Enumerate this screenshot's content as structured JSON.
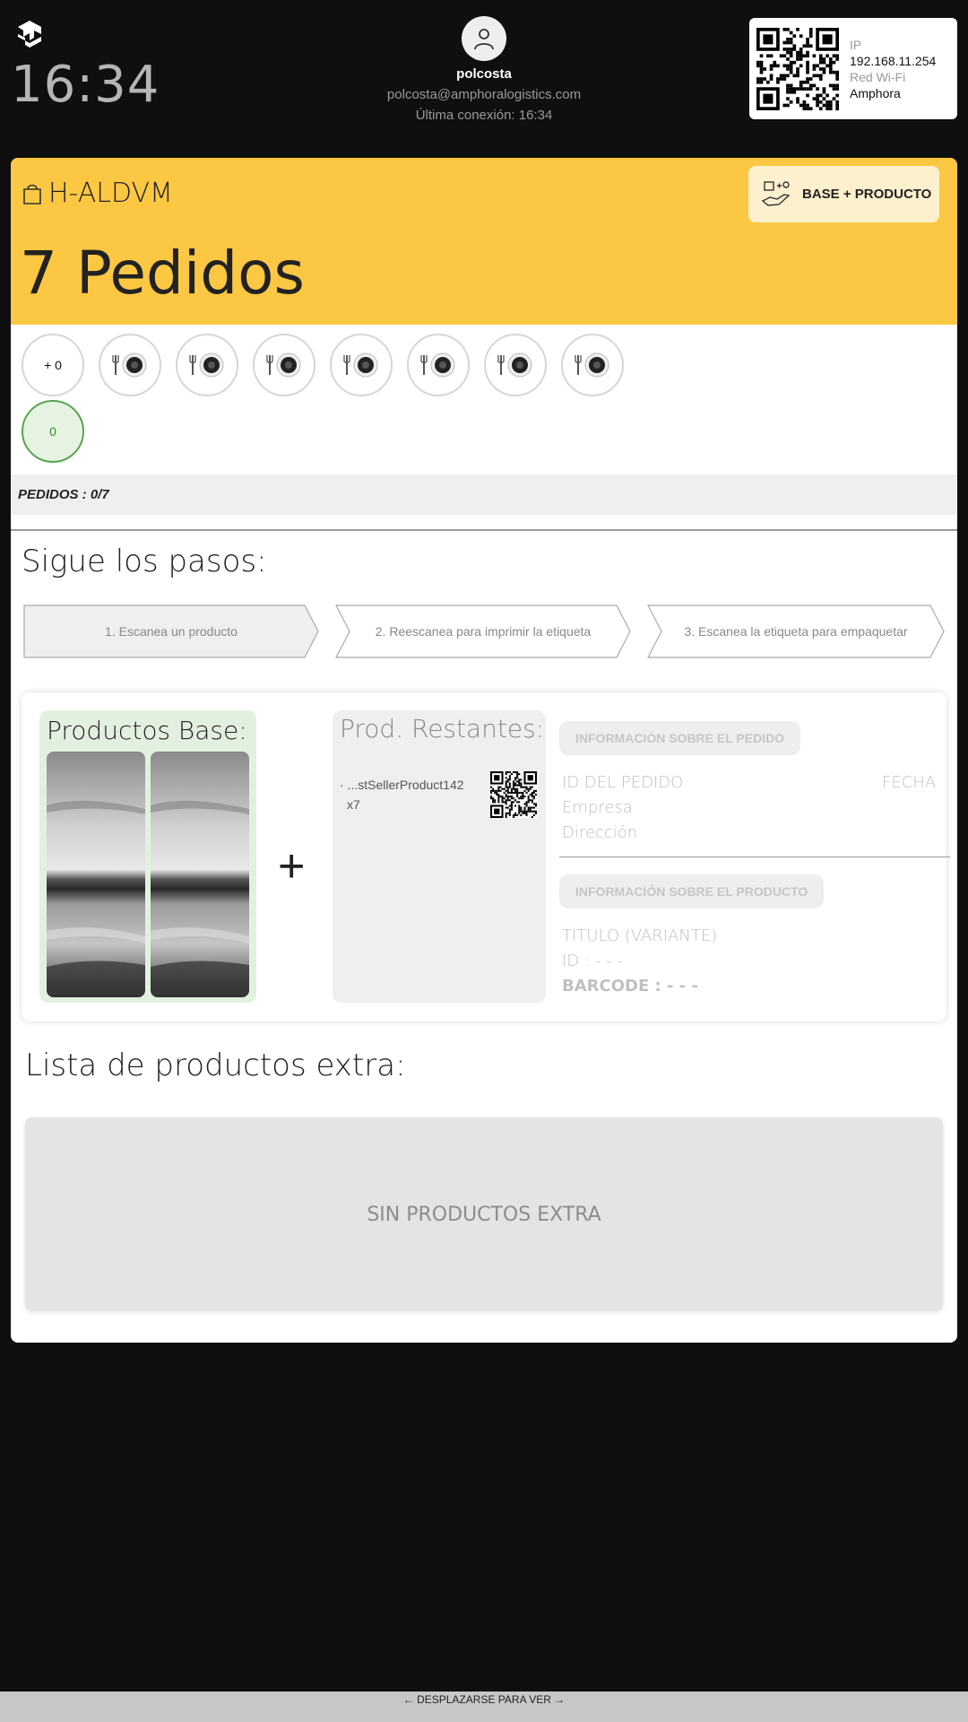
{
  "header": {
    "clock": "16:34",
    "user_name": "polcosta",
    "user_email": "polcosta@amphoralogistics.com",
    "last_connection": "Última conexión: 16:34",
    "network": {
      "ip_label": "IP",
      "ip_value": "192.168.11.254",
      "wifi_label": "Red Wi-Fi",
      "wifi_value": "Amphora"
    }
  },
  "order": {
    "code": "H-ALDVM",
    "title": "7 Pedidos",
    "mode_button": "BASE + PRODUCTO",
    "plus_counter": "+ 0",
    "done_counter": "0",
    "order_slots": 7,
    "progress_label": "PEDIDOS : 0/7"
  },
  "steps": {
    "title": "Sigue los pasos:",
    "items": [
      "1. Escanea un producto",
      "2. Reescanea para imprimir la etiqueta",
      "3. Escanea la etiqueta para empaquetar"
    ]
  },
  "panel": {
    "base_title": "Productos Base:",
    "plus": "+",
    "remaining_title": "Prod. Restantes:",
    "remaining_item": "· ...stSellerProduct142",
    "remaining_qty": "x7",
    "order_info_title": "INFORMACIÓN SOBRE EL PEDIDO",
    "order_id_label": "ID DEL PEDIDO",
    "date_label": "FECHA",
    "company_label": "Empresa",
    "address_label": "Dirección",
    "product_info_title": "INFORMACIÓN SOBRE EL PRODUCTO",
    "product_title_label": "TITULO (VARIANTE)",
    "product_id_label": "ID : - - -",
    "barcode_label": "BARCODE : - - -"
  },
  "extra": {
    "title": "Lista de productos extra:",
    "empty": "SIN PRODUCTOS EXTRA"
  },
  "footer": {
    "hint": "← DESPLAZARSE PARA VER →"
  },
  "colors": {
    "banner": "#fcc843",
    "mode_button_bg": "#fdf0cc",
    "base_bg": "#e2f1df",
    "done_green": "#58a44f",
    "page_bg": "#0f0f0f"
  },
  "icons": [
    "app-logo-icon",
    "user-icon",
    "bag-icon",
    "hand-box-icon",
    "plate-cutlery-icon",
    "qr-code-icon"
  ]
}
